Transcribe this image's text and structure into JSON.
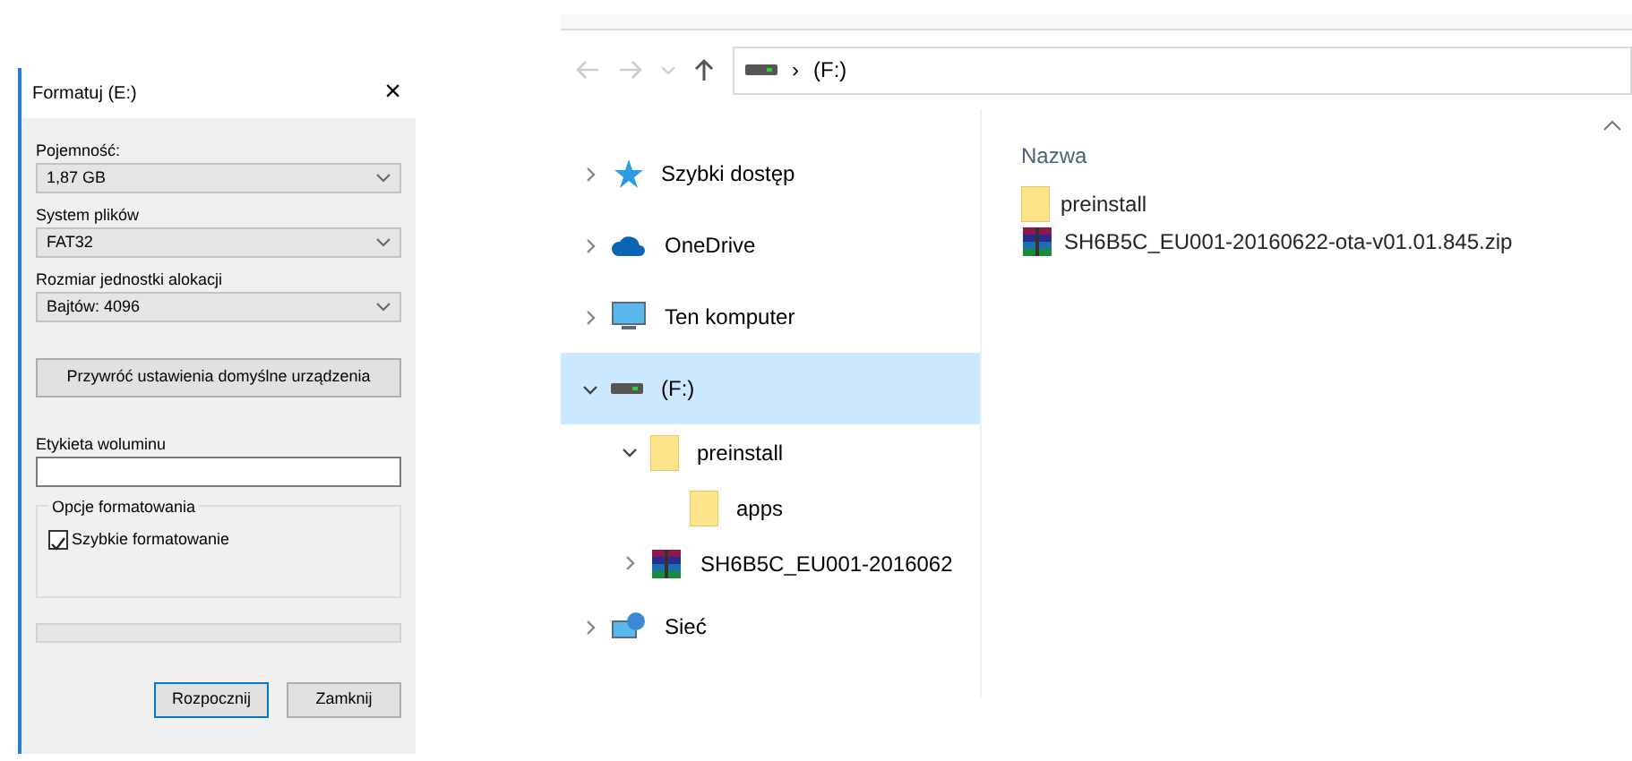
{
  "format_dialog": {
    "title": "Formatuj  (E:)",
    "close": "×",
    "fields": [
      {
        "label": "Pojemność:",
        "value": "1,87 GB"
      },
      {
        "label": "System plików",
        "value": "FAT32"
      },
      {
        "label": "Rozmiar jednostki alokacji",
        "value": "Bajtów: 4096"
      }
    ],
    "restore_button": "Przywróć ustawienia domyślne urządzenia",
    "volume_label": {
      "label": "Etykieta woluminu"
    },
    "options": {
      "title": "Opcje formatowania",
      "items": [
        {
          "label": "Szybkie formatowanie",
          "checked": true
        }
      ]
    },
    "progress": {
      "level": 0
    },
    "buttons": [
      {
        "label": "Rozpocznij",
        "selected": true
      },
      {
        "label": "Zamknij",
        "selected": false
      }
    ]
  },
  "explorer": {
    "address": {
      "separator": "›",
      "path": "(F:)"
    },
    "tree": [
      {
        "label": "Szybki dostęp",
        "kind": "star",
        "expanded": false,
        "selected": false
      },
      {
        "label": "OneDrive",
        "kind": "cloud",
        "expanded": false,
        "selected": false
      },
      {
        "label": "Ten komputer",
        "kind": "computer",
        "expanded": false,
        "selected": false
      },
      {
        "label": "(F:)",
        "kind": "drive",
        "expanded": true,
        "selected": true,
        "children": [
          {
            "label": "preinstall",
            "kind": "folder",
            "expanded": true,
            "selected": false,
            "children": [
              {
                "label": "apps",
                "kind": "folder",
                "selected": false
              }
            ]
          },
          {
            "label": "SH6B5C_EU001-2016062",
            "kind": "archive",
            "expanded": false,
            "selected": false
          }
        ]
      },
      {
        "label": "Sieć",
        "kind": "network",
        "expanded": false,
        "selected": false
      }
    ],
    "column_header": "Nazwa",
    "files": [
      {
        "name": "preinstall",
        "kind": "folder"
      },
      {
        "name": "SH6B5C_EU001-20160622-ota-v01.01.845.zip",
        "kind": "archive"
      }
    ]
  }
}
